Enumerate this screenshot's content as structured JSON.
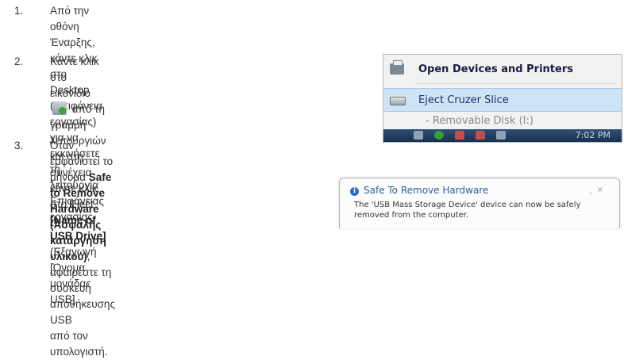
{
  "steps": [
    {
      "number": "1.",
      "line1": "Από την οθόνη Έναρξης, κάντε κλικ στο Desktop (Επιφάνεια εργασίας) για να εκκινήσετε τη",
      "line2": "λειτουργία Επιφάνειας εργασίας."
    },
    {
      "number": "2.",
      "line1_before": "Κάντε κλικ στο εικονίδιο",
      "line1_after": "από τη γραμμή",
      "line2": "λειτουργιών και στη συνέχεια κάντε κλικ στο Eject",
      "line3_bold": "[Name of USB Drive]",
      "line3_rest": " (Εξαγωγή [Όνομα μονάδας",
      "line4": "USB]."
    },
    {
      "number": "3.",
      "line1_before": "Όταν εμφανιστεί το μήνυμα ",
      "line1_bold": "Safe to Remove",
      "line2_bold": "Hardware (Ασφαλής κατάργηση υλικού)",
      "line2_rest": ",",
      "line3": "αφαιρέστε τη συσκευή αποθήκευσης USB",
      "line4": "από τον υπολογιστή."
    }
  ],
  "menu": {
    "item1": "Open Devices and Printers",
    "item2": "Eject Cruzer Slice",
    "item3": "- Removable Disk (I:)",
    "time": "7:02 PM"
  },
  "balloon": {
    "title": "Safe To Remove Hardware",
    "message": "The 'USB Mass Storage Device' device can now be safely removed from the computer."
  },
  "icons": {
    "tray": "usb-eject-icon",
    "printer": "printer-icon",
    "drive": "usb-drive-icon",
    "info": "info-icon"
  }
}
